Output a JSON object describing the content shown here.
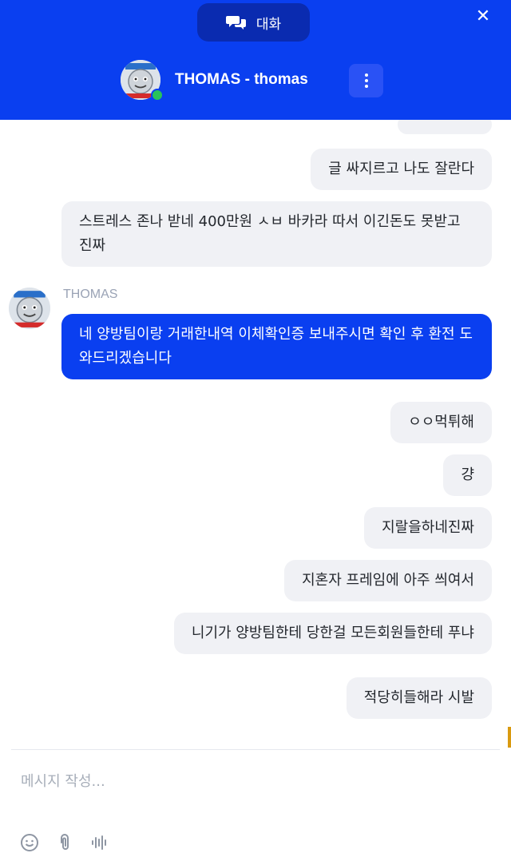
{
  "header": {
    "tab_label": "대화",
    "agent_name": "THOMAS - thomas",
    "icons": {
      "tab": "chat-bubbles-icon",
      "close": "close-icon",
      "more": "more-vertical-icon"
    }
  },
  "messages": {
    "cut_top": "~~~~~",
    "m1": "글 싸지르고 나도 잘란다",
    "m2": "스트레스 존나 받네 400만원 ㅅㅂ 바카라 따서 이긴돈도 못받고 진짜",
    "agent_sender": "THOMAS",
    "agent_msg": "네 양방팀이랑 거래한내역 이체확인증 보내주시면 확인 후 환전 도와드리겠습니다",
    "m3": "ㅇㅇ먹튀해",
    "m4": "걍",
    "m5": "지랄을하네진짜",
    "m6": "지혼자 프레임에 아주 씌여서",
    "m7": "니기가 양방팀한테 당한걸 모든회원들한테 푸냐",
    "m8": "적당히들해라 시발"
  },
  "composer": {
    "placeholder": "메시지 작성...",
    "icons": [
      "emoji-icon",
      "attachment-icon",
      "voice-icon"
    ]
  },
  "colors": {
    "brand": "#0a3ff0",
    "bubble": "#f0f1f5"
  }
}
